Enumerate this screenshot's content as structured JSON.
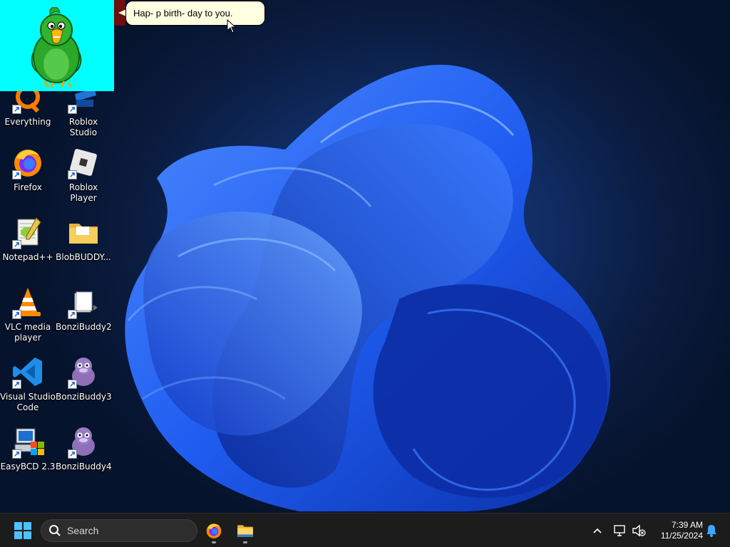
{
  "desktop": {
    "icons": [
      {
        "label": "Everything",
        "icon": "everything-icon"
      },
      {
        "label": "Roblox Studio",
        "icon": "roblox-studio-icon"
      },
      {
        "label": "Firefox",
        "icon": "firefox-icon"
      },
      {
        "label": "Roblox Player",
        "icon": "roblox-player-icon"
      },
      {
        "label": "Notepad++",
        "icon": "notepadpp-icon"
      },
      {
        "label": "BlobBUDDY...",
        "icon": "folder-icon"
      },
      {
        "label": "VLC media player",
        "icon": "vlc-icon"
      },
      {
        "label": "BonziBuddy2",
        "icon": "bonzibuddy2-icon"
      },
      {
        "label": "Visual Studio Code",
        "icon": "vscode-icon"
      },
      {
        "label": "BonziBuddy3",
        "icon": "bonzibuddy3-icon"
      },
      {
        "label": "EasyBCD 2.3",
        "icon": "easybcd-icon"
      },
      {
        "label": "BonziBuddy4",
        "icon": "bonzibuddy4-icon"
      }
    ]
  },
  "agent": {
    "character": "green-parrot-icon",
    "speech": "Hap- p birth- day to you."
  },
  "taskbar": {
    "search_placeholder": "Search",
    "pinned": [
      "firefox-icon",
      "file-explorer-icon"
    ],
    "tray": {
      "overflow": "chevron-up-icon",
      "network": "network-icon",
      "volume": "volume-muted-icon",
      "notification": "bell-icon"
    },
    "clock": {
      "time": "7:39 AM",
      "date": "11/25/2024"
    }
  },
  "colors": {
    "agent_bg": "#00ffff",
    "bubble_bg": "#ffffe1",
    "taskbar_bg": "#1c1c1c",
    "accent": "#3ea6ff"
  }
}
